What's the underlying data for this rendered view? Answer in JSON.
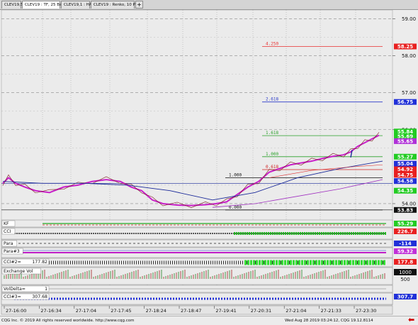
{
  "tabs": [
    {
      "label": "CLEV19,5",
      "active": false
    },
    {
      "label": "CLEV19 : TF, 25 Bars",
      "active": true
    },
    {
      "label": "CLEV19,1 : HA",
      "active": false
    },
    {
      "label": "CLEV19 : Renko, 10 Price",
      "active": false
    }
  ],
  "add_tab_symbol": "+",
  "price_axis": {
    "ticks": [
      {
        "value": 59.0,
        "label": "59.00"
      },
      {
        "value": 58.0,
        "label": "58.00"
      },
      {
        "value": 57.0,
        "label": "57.00"
      },
      {
        "value": 56.0,
        "label": "56.00"
      },
      {
        "value": 54.0,
        "label": "54.00"
      }
    ],
    "range": [
      53.75,
      59.2
    ]
  },
  "fib_levels": [
    {
      "label": "4.250",
      "price": 58.25,
      "color": "#e83030"
    },
    {
      "label": "2.618",
      "price": 56.75,
      "color": "#2b3ac9"
    },
    {
      "label": "1.618",
      "price": 55.84,
      "color": "#2aa12a"
    },
    {
      "label": "1.000",
      "price": 55.27,
      "color": "#2aa12a"
    },
    {
      "label": "0.618",
      "price": 54.92,
      "color": "#d02020"
    },
    {
      "label": "1.000",
      "price": 54.7,
      "color": "#111111"
    },
    {
      "label": "0.000",
      "price": 53.83,
      "color": "#111111"
    }
  ],
  "price_badges": [
    {
      "value": "58.25",
      "price": 58.25,
      "bg": "#e82020",
      "fg": "#ffffff"
    },
    {
      "value": "56.75",
      "price": 56.75,
      "bg": "#2030d8",
      "fg": "#ffffff"
    },
    {
      "value": "55.84",
      "price": 55.95,
      "bg": "#22cc22",
      "fg": "#ffffff"
    },
    {
      "value": "55.69",
      "price": 55.82,
      "bg": "#22cc22",
      "fg": "#ffffff"
    },
    {
      "value": "55.65",
      "price": 55.69,
      "bg": "#b030d8",
      "fg": "#ffffff"
    },
    {
      "value": "55.27",
      "price": 55.27,
      "bg": "#22cc22",
      "fg": "#ffffff"
    },
    {
      "value": "55.04",
      "price": 55.08,
      "bg": "#2030d8",
      "fg": "#ffffff"
    },
    {
      "value": "54.92",
      "price": 54.93,
      "bg": "#e82020",
      "fg": "#ffffff"
    },
    {
      "value": "54.75",
      "price": 54.78,
      "bg": "#e82020",
      "fg": "#ffffff"
    },
    {
      "value": "54.58",
      "price": 54.61,
      "bg": "#2030d8",
      "fg": "#ffffff"
    },
    {
      "value": "54.35",
      "price": 54.35,
      "bg": "#22cc22",
      "fg": "#ffffff"
    },
    {
      "value": "53.83",
      "price": 53.83,
      "bg": "#111111",
      "fg": "#ffffff"
    }
  ],
  "time_axis": [
    "27-16:00",
    "27-16:34",
    "27-17:04",
    "27-17:45",
    "27-18:24",
    "27-18:47",
    "27-19:41",
    "27-20:31",
    "27-21:04",
    "27-21:33",
    "27-23:30"
  ],
  "panels": [
    {
      "id": "kf",
      "label": "KF",
      "badge": "55.29",
      "badge_bg": "#22cc22",
      "badge_fg": "#ffffff"
    },
    {
      "id": "cci",
      "label": "CCI",
      "badge": "226.7",
      "badge_bg": "#e82020",
      "badge_fg": "#ffffff"
    },
    {
      "id": "para",
      "label": "Para",
      "badge": "-114",
      "badge_bg": "#2030d8",
      "badge_fg": "#ffffff"
    },
    {
      "id": "para3",
      "label": "Para#3",
      "badge": "59.32",
      "badge_bg": "#c030d8",
      "badge_fg": "#ffffff"
    },
    {
      "id": "cci2",
      "label": "CCI#2=",
      "value": "177.82",
      "badge": "177.8",
      "badge_bg": "#e82020",
      "badge_fg": "#ffffff"
    },
    {
      "id": "exvol",
      "label": "Exchange Vol",
      "badges": [
        {
          "value": "1000",
          "bg": "#111111",
          "fg": "#ffffff"
        },
        {
          "value": "500",
          "bg": "#ececec",
          "fg": "#111111"
        }
      ]
    },
    {
      "id": "voldelta",
      "label": "VolDelta=",
      "value": "1"
    },
    {
      "id": "cci3",
      "label": "CCI#3=",
      "value": "307.68",
      "badge": "307.7",
      "badge_bg": "#2030d8",
      "badge_fg": "#ffffff"
    }
  ],
  "footer": {
    "left": "CQG Inc. © 2019 All rights reserved worldwide. http://www.cqg.com",
    "right": "Wed Aug 28 2019 03:24:12, CQG 19.12.8114",
    "arrow": "⬅"
  }
}
